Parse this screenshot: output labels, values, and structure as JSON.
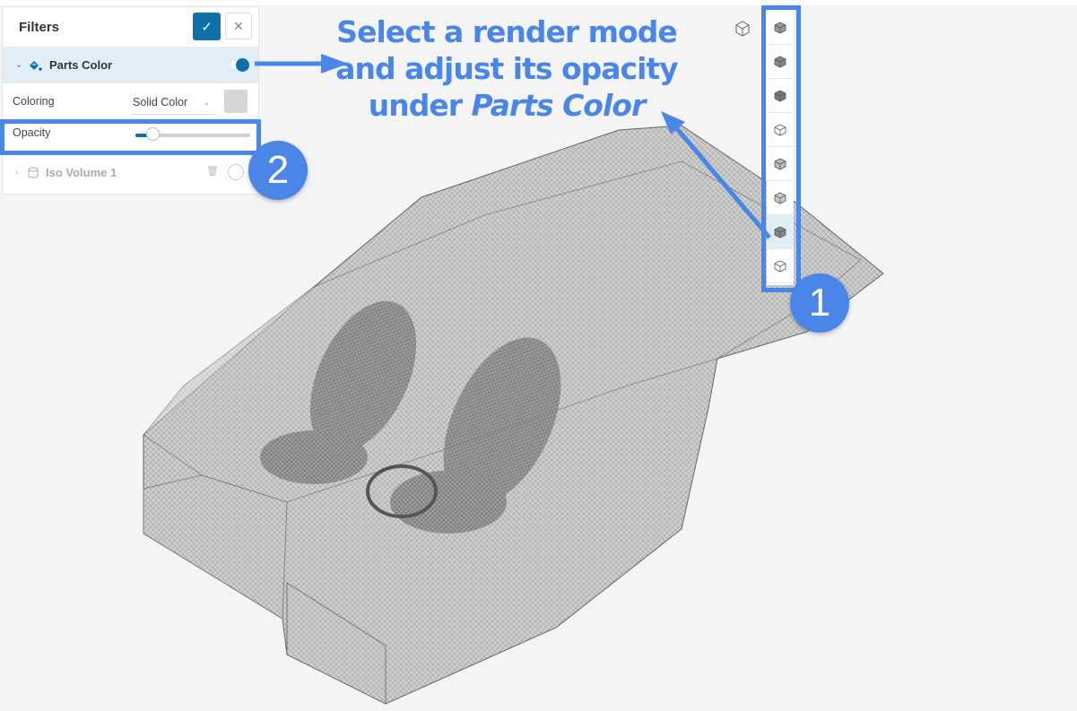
{
  "filters_panel": {
    "title": "Filters",
    "confirm_icon": "check-icon",
    "close_icon": "close-icon",
    "confirm_glyph": "✓",
    "close_glyph": "✕",
    "parts_color": {
      "label": "Parts Color",
      "expanded": true,
      "enabled": true,
      "coloring_label": "Coloring",
      "coloring_value": "Solid Color",
      "swatch_color": "#d6d6d6",
      "opacity_label": "Opacity",
      "opacity_value": 0.15
    },
    "iso_volume": {
      "label": "Iso Volume 1",
      "expanded": false,
      "enabled": false
    }
  },
  "annotation": {
    "line1": "Select a render mode",
    "line2": "and adjust its opacity",
    "line3_prefix": "under ",
    "line3_italic": "Parts Color",
    "badge1": "1",
    "badge2": "2",
    "color": "#4a86e8"
  },
  "render_toolbar": {
    "modes": [
      {
        "name": "surfaces-with-mesh",
        "icon": "cube-mesh-icon"
      },
      {
        "name": "surfaces",
        "icon": "cube-solid-icon"
      },
      {
        "name": "surfaces-with-edges",
        "icon": "cube-edges-icon"
      },
      {
        "name": "feature-edges",
        "icon": "cube-outline-icon"
      },
      {
        "name": "transparent",
        "icon": "cube-transparent-icon"
      },
      {
        "name": "transparent-light",
        "icon": "cube-light-icon"
      },
      {
        "name": "transparent-mesh",
        "icon": "cube-transparent-mesh-icon",
        "active": true
      },
      {
        "name": "wireframe",
        "icon": "cube-wireframe-icon"
      }
    ]
  },
  "colors": {
    "accent": "#0e70a8",
    "selected_row": "#e1eef6",
    "annotation_blue": "#4a86e8"
  }
}
